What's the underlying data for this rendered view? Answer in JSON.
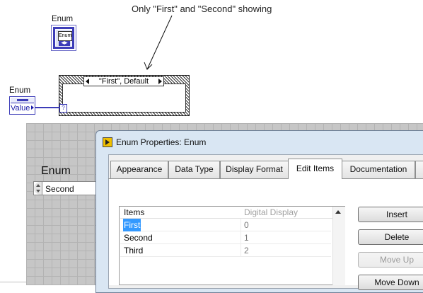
{
  "annotation": "Only \"First\" and \"Second\" showing",
  "block_diagram": {
    "terminal_label": "Enum",
    "terminal_face": "Enum",
    "case_selector": "\"First\", Default",
    "case_selector_icon": "question-mark",
    "constant_label": "Enum",
    "constant_value": "Value"
  },
  "front_panel": {
    "control_label": "Enum",
    "control_value": "Second"
  },
  "dialog": {
    "title": "Enum Properties: Enum",
    "tabs": [
      "Appearance",
      "Data Type",
      "Display Format",
      "Edit Items",
      "Documentation"
    ],
    "active_tab": "Edit Items",
    "table": {
      "headers": [
        "Items",
        "Digital Display"
      ],
      "rows": [
        {
          "item": "First",
          "value": "0",
          "selected": true
        },
        {
          "item": "Second",
          "value": "1",
          "selected": false
        },
        {
          "item": "Third",
          "value": "2",
          "selected": false
        }
      ]
    },
    "buttons": [
      {
        "label": "Insert",
        "enabled": true
      },
      {
        "label": "Delete",
        "enabled": true
      },
      {
        "label": "Move Up",
        "enabled": false
      },
      {
        "label": "Move Down",
        "enabled": true
      }
    ]
  },
  "colors": {
    "labview_blue": "#3c3cb8",
    "selection": "#3399ff",
    "dialog_frame": "#d9e6f3",
    "front_panel_grid": "#c6c6c6"
  }
}
